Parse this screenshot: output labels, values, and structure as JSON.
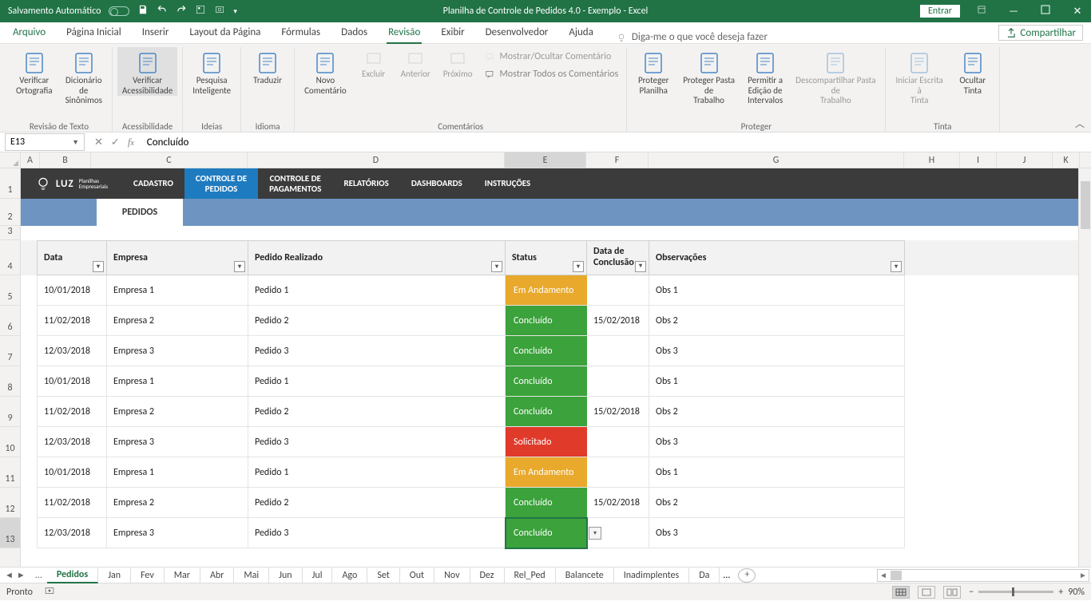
{
  "titlebar": {
    "autosave": "Salvamento Automático",
    "title": "Planilha de Controle de Pedidos 4.0 - Exemplo  -  Excel",
    "signin": "Entrar"
  },
  "menu": {
    "tabs": [
      "Arquivo",
      "Página Inicial",
      "Inserir",
      "Layout da Página",
      "Fórmulas",
      "Dados",
      "Revisão",
      "Exibir",
      "Desenvolvedor",
      "Ajuda"
    ],
    "active_index": 6,
    "tell_me": "Diga-me o que você deseja fazer",
    "share": "Compartilhar"
  },
  "ribbon": {
    "groups": [
      {
        "name": "Revisão de Texto",
        "items": [
          {
            "label": "Verificar Ortografia"
          },
          {
            "label": "Dicionário de Sinônimos"
          }
        ]
      },
      {
        "name": "Acessibilidade",
        "items": [
          {
            "label": "Verificar Acessibilidade",
            "selected": true
          }
        ]
      },
      {
        "name": "Ideias",
        "items": [
          {
            "label": "Pesquisa Inteligente"
          }
        ]
      },
      {
        "name": "Idioma",
        "items": [
          {
            "label": "Traduzir"
          }
        ]
      },
      {
        "name": "Comentários",
        "items": [
          {
            "label": "Novo Comentário"
          },
          {
            "label": "Excluir",
            "dimmed": true,
            "small": true
          },
          {
            "label": "Anterior",
            "dimmed": true,
            "small": true
          },
          {
            "label": "Próximo",
            "dimmed": true,
            "small": true
          },
          {
            "label": "Mostrar/Ocultar Comentário",
            "dimmed": true,
            "inline": true
          },
          {
            "label": "Mostrar Todos os Comentários",
            "inline": true
          }
        ]
      },
      {
        "name": "Proteger",
        "items": [
          {
            "label": "Proteger Planilha"
          },
          {
            "label": "Proteger Pasta de Trabalho"
          },
          {
            "label": "Permitir a Edição de Intervalos"
          },
          {
            "label": "Descompartilhar Pasta de Trabalho",
            "dimmed": true
          }
        ]
      },
      {
        "name": "Tinta",
        "items": [
          {
            "label": "Iniciar Escrita à Tinta",
            "dimmed": true
          },
          {
            "label": "Ocultar Tinta"
          }
        ]
      }
    ]
  },
  "namebox": "E13",
  "formula": "Concluído",
  "col_letters": [
    "A",
    "B",
    "C",
    "D",
    "E",
    "F",
    "G",
    "H",
    "I",
    "J",
    "K"
  ],
  "active_col": "E",
  "row_numbers": [
    "1",
    "2",
    "3",
    "4",
    "5",
    "6",
    "7",
    "8",
    "9",
    "10",
    "11",
    "12",
    "13"
  ],
  "active_row": "13",
  "nav": {
    "logo": "LUZ",
    "logo_sub1": "Planilhas",
    "logo_sub2": "Empresariais",
    "items": [
      {
        "line1": "CADASTRO"
      },
      {
        "line1": "CONTROLE DE",
        "line2": "PEDIDOS",
        "active": true
      },
      {
        "line1": "CONTROLE DE",
        "line2": "PAGAMENTOS"
      },
      {
        "line1": "RELATÓRIOS"
      },
      {
        "line1": "DASHBOARDS"
      },
      {
        "line1": "INSTRUÇÕES"
      }
    ]
  },
  "pedidos_tab": "PEDIDOS",
  "table": {
    "headers": {
      "data": "Data",
      "empresa": "Empresa",
      "pedido": "Pedido Realizado",
      "status": "Status",
      "dc1": "Data de",
      "dc2": "Conclusão",
      "obs": "Observações"
    },
    "rows": [
      {
        "data": "10/01/2018",
        "emp": "Empresa 1",
        "ped": "Pedido 1",
        "status": "Em Andamento",
        "status_k": "andamento",
        "dc": "",
        "obs": "Obs 1"
      },
      {
        "data": "11/02/2018",
        "emp": "Empresa 2",
        "ped": "Pedido 2",
        "status": "Concluído",
        "status_k": "concluido",
        "dc": "15/02/2018",
        "obs": "Obs 2"
      },
      {
        "data": "12/03/2018",
        "emp": "Empresa 3",
        "ped": "Pedido 3",
        "status": "Concluído",
        "status_k": "concluido",
        "dc": "",
        "obs": "Obs 3"
      },
      {
        "data": "10/01/2018",
        "emp": "Empresa 1",
        "ped": "Pedido 1",
        "status": "Concluído",
        "status_k": "concluido",
        "dc": "",
        "obs": "Obs 1"
      },
      {
        "data": "11/02/2018",
        "emp": "Empresa 2",
        "ped": "Pedido 2",
        "status": "Concluído",
        "status_k": "concluido",
        "dc": "15/02/2018",
        "obs": "Obs 2"
      },
      {
        "data": "12/03/2018",
        "emp": "Empresa 3",
        "ped": "Pedido 3",
        "status": "Solicitado",
        "status_k": "solicitado",
        "dc": "",
        "obs": "Obs 3"
      },
      {
        "data": "10/01/2018",
        "emp": "Empresa 1",
        "ped": "Pedido 1",
        "status": "Em Andamento",
        "status_k": "andamento",
        "dc": "",
        "obs": "Obs 1"
      },
      {
        "data": "11/02/2018",
        "emp": "Empresa 2",
        "ped": "Pedido 2",
        "status": "Concluído",
        "status_k": "concluido",
        "dc": "15/02/2018",
        "obs": "Obs 2"
      },
      {
        "data": "12/03/2018",
        "emp": "Empresa 3",
        "ped": "Pedido 3",
        "status": "Concluído",
        "status_k": "concluido",
        "dc": "",
        "obs": "Obs 3",
        "active": true
      }
    ]
  },
  "sheets": {
    "tabs": [
      "Pedidos",
      "Jan",
      "Fev",
      "Mar",
      "Abr",
      "Mai",
      "Jun",
      "Jul",
      "Ago",
      "Set",
      "Out",
      "Nov",
      "Dez",
      "Rel_Ped",
      "Balancete",
      "Inadimplentes",
      "Da"
    ],
    "active_index": 0,
    "overflow": "..."
  },
  "statusbar": {
    "ready": "Pronto",
    "zoom": "90%"
  }
}
